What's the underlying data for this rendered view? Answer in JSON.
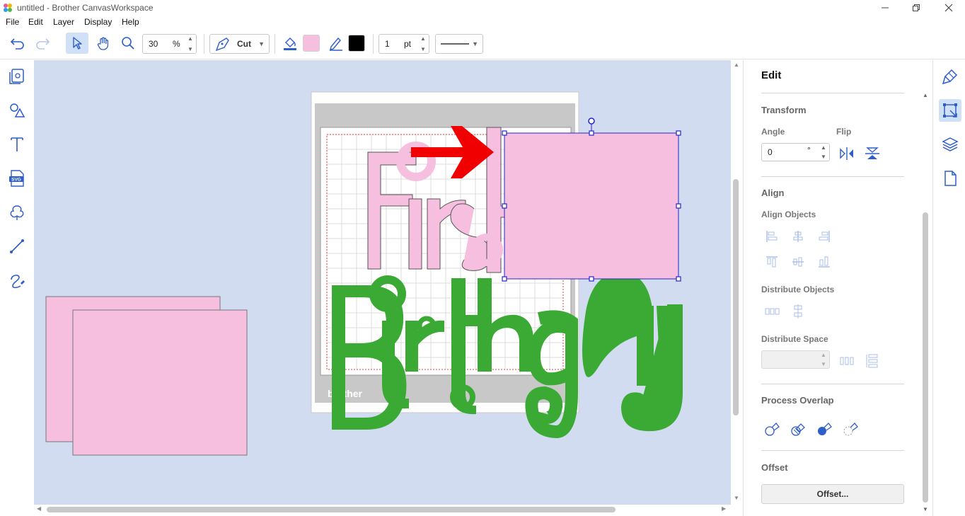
{
  "window": {
    "title": "untitled - Brother CanvasWorkspace"
  },
  "menu": [
    "File",
    "Edit",
    "Layer",
    "Display",
    "Help"
  ],
  "toolbar": {
    "zoom_value": "30",
    "zoom_unit": "%",
    "mode_label": "Cut",
    "fill_color": "#f6bfe0",
    "line_color": "#000000",
    "line_width_value": "1",
    "line_width_unit": "pt"
  },
  "canvas": {
    "background": "#d2dcf0",
    "mat_brand": "brother",
    "text_first": "First",
    "text_birthday": "Birthday",
    "first_color": "#f6bfe0",
    "birthday_color": "#3aaa35",
    "arrow_color": "#f00000"
  },
  "panel": {
    "title": "Edit",
    "transform": {
      "heading": "Transform",
      "angle_label": "Angle",
      "angle_value": "0",
      "angle_unit": "°",
      "flip_label": "Flip"
    },
    "align": {
      "heading": "Align",
      "align_objects_label": "Align Objects",
      "distribute_objects_label": "Distribute Objects",
      "distribute_space_label": "Distribute Space"
    },
    "process_overlap": {
      "heading": "Process Overlap"
    },
    "offset": {
      "heading": "Offset",
      "button_label": "Offset..."
    }
  }
}
